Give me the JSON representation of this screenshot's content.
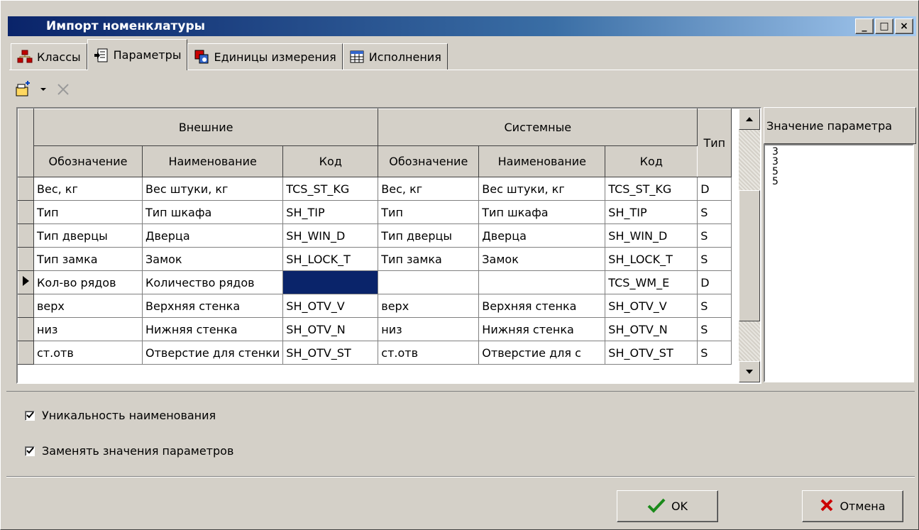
{
  "window": {
    "title": "Импорт номенклатуры",
    "controls": {
      "minimize": "_",
      "maximize": "□",
      "close": "×"
    }
  },
  "tabs": [
    {
      "label": "Классы",
      "icon": "classes-icon",
      "active": false
    },
    {
      "label": "Параметры",
      "icon": "parameters-icon",
      "active": true
    },
    {
      "label": "Единицы измерения",
      "icon": "units-icon",
      "active": false
    },
    {
      "label": "Исполнения",
      "icon": "versions-icon",
      "active": false
    }
  ],
  "toolbar": {
    "buttons": [
      {
        "name": "add-parameter-icon"
      },
      {
        "name": "dropdown-arrow-icon"
      },
      {
        "name": "delete-icon"
      }
    ]
  },
  "grid": {
    "groups": {
      "external": "Внешние",
      "system": "Системные",
      "type": "Тип"
    },
    "columns": [
      "Обозначение",
      "Наименование",
      "Код",
      "Обозначение",
      "Наименование",
      "Код"
    ],
    "rows": [
      {
        "current": false,
        "cells": [
          "Вес, кг",
          "Вес штуки, кг",
          "TCS_ST_KG",
          "Вес, кг",
          "Вес штуки, кг",
          "TCS_ST_KG",
          "D"
        ]
      },
      {
        "current": false,
        "cells": [
          "Тип",
          "Тип шкафа",
          "SH_TIP",
          "Тип",
          "Тип шкафа",
          "SH_TIP",
          "S"
        ]
      },
      {
        "current": false,
        "cells": [
          "Тип дверцы",
          "Дверца",
          "SH_WIN_D",
          "Тип дверцы",
          "Дверца",
          "SH_WIN_D",
          "S"
        ]
      },
      {
        "current": false,
        "cells": [
          "Тип замка",
          "Замок",
          "SH_LOCK_T",
          "Тип замка",
          "Замок",
          "SH_LOCK_T",
          "S"
        ]
      },
      {
        "current": true,
        "cells": [
          "Кол-во рядов",
          "Количество рядов",
          "",
          "",
          "",
          "TCS_WM_E",
          "D"
        ]
      },
      {
        "current": false,
        "cells": [
          "верх",
          "Верхняя стенка",
          "SH_OTV_V",
          "верх",
          "Верхняя стенка",
          "SH_OTV_V",
          "S"
        ]
      },
      {
        "current": false,
        "cells": [
          "низ",
          "Нижняя стенка",
          "SH_OTV_N",
          "низ",
          "Нижняя стенка",
          "SH_OTV_N",
          "S"
        ]
      },
      {
        "current": false,
        "cells": [
          "ст.отв",
          "Отверстие для стенки",
          "SH_OTV_ST",
          "ст.отв",
          "Отверстие для с",
          "SH_OTV_ST",
          "S"
        ]
      }
    ],
    "selected_color": "#0a246a"
  },
  "param_panel": {
    "title": "Значение параметра",
    "values": [
      "3",
      "3",
      "5",
      "5"
    ]
  },
  "options": [
    {
      "label": "Уникальность наименования",
      "checked": true
    },
    {
      "label": "Заменять значения параметров",
      "checked": true
    }
  ],
  "buttons": {
    "ok": {
      "label": "OK",
      "icon": "checkmark-icon",
      "color": "#1a8a1a"
    },
    "cancel": {
      "label": "Отмена",
      "icon": "cross-icon",
      "color": "#cc0000"
    }
  }
}
